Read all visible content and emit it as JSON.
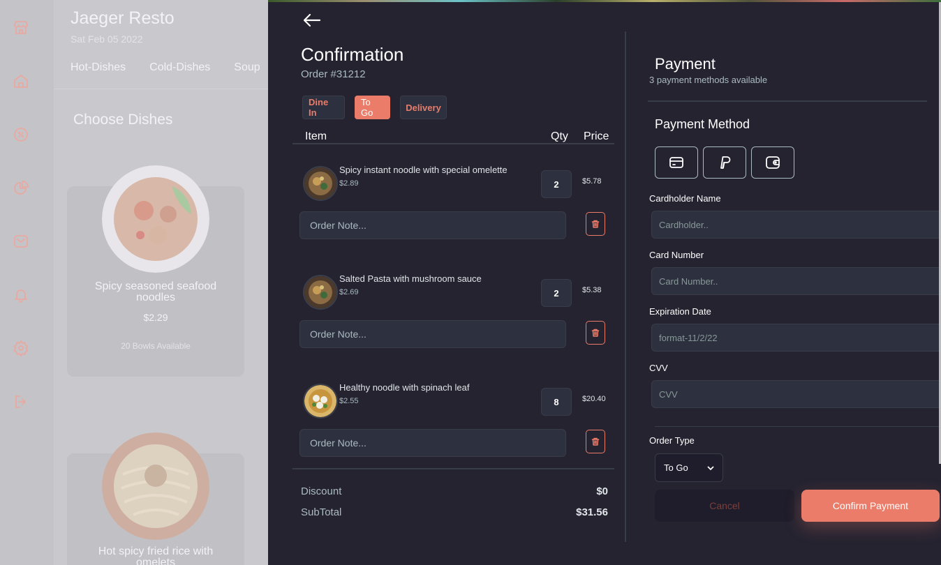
{
  "background": {
    "restaurant_name": "Jaeger Resto",
    "date": "Sat Feb 05 2022",
    "tabs": [
      "Hot-Dishes",
      "Cold-Dishes",
      "Soup"
    ],
    "section_title": "Choose Dishes",
    "dishes": [
      {
        "name": "Spicy seasoned seafood noodles",
        "price": "$2.29",
        "availability": "20 Bowls Available"
      },
      {
        "name": "Hot spicy fried rice with omelets"
      }
    ],
    "nav_icons": [
      "store-icon",
      "home-icon",
      "discount-icon",
      "pie-chart-icon",
      "mail-icon",
      "bell-icon",
      "gear-icon",
      "logout-icon"
    ]
  },
  "confirmation": {
    "title": "Confirmation",
    "order_number": "Order #31212",
    "order_types": [
      "Dine In",
      "To Go",
      "Delivery"
    ],
    "active_order_type": "To Go",
    "columns": {
      "item": "Item",
      "qty": "Qty",
      "price": "Price"
    },
    "items": [
      {
        "name": "Spicy instant noodle with special omelette",
        "unit_price": "$2.89",
        "qty": "2",
        "total": "$5.78",
        "note_placeholder": "Order Note..."
      },
      {
        "name": "Salted Pasta with mushroom sauce",
        "unit_price": "$2.69",
        "qty": "2",
        "total": "$5.38",
        "note_placeholder": "Order Note..."
      },
      {
        "name": "Healthy noodle with spinach leaf",
        "unit_price": "$2.55",
        "qty": "8",
        "total": "$20.40",
        "note_placeholder": "Order Note..."
      }
    ],
    "discount_label": "Discount",
    "discount_value": "$0",
    "subtotal_label": "SubTotal",
    "subtotal_value": "$31.56"
  },
  "payment": {
    "title": "Payment",
    "subtitle": "3 payment methods available",
    "method_title": "Payment Method",
    "methods": [
      "credit-card-icon",
      "paypal-icon",
      "wallet-icon"
    ],
    "fields": {
      "cardholder_label": "Cardholder Name",
      "cardholder_placeholder": "Cardholder..",
      "card_number_label": "Card Number",
      "card_number_placeholder": "Card Number..",
      "expiration_label": "Expiration Date",
      "expiration_placeholder": "format-11/2/22",
      "cvv_label": "CVV",
      "cvv_placeholder": "CVV"
    },
    "order_type_label": "Order Type",
    "order_type_value": "To Go",
    "cancel_label": "Cancel",
    "confirm_label": "Confirm Payment"
  }
}
